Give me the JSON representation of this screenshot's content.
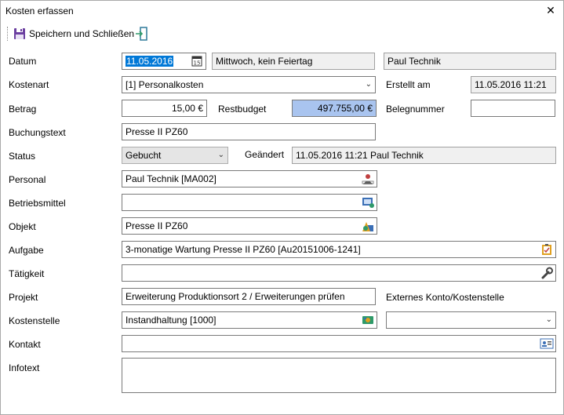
{
  "window": {
    "title": "Kosten erfassen"
  },
  "toolbar": {
    "save_label": "Speichern und Schließen"
  },
  "labels": {
    "datum": "Datum",
    "kostenart": "Kostenart",
    "betrag": "Betrag",
    "buchungstext": "Buchungstext",
    "status": "Status",
    "personal": "Personal",
    "betriebsmittel": "Betriebsmittel",
    "objekt": "Objekt",
    "aufgabe": "Aufgabe",
    "taetigkeit": "Tätigkeit",
    "projekt": "Projekt",
    "kostenstelle": "Kostenstelle",
    "kontakt": "Kontakt",
    "infotext": "Infotext",
    "restbudget": "Restbudget",
    "erstellt_am": "Erstellt am",
    "belegnummer": "Belegnummer",
    "geaendert": "Geändert",
    "externes_konto": "Externes Konto/Kostenstelle"
  },
  "values": {
    "datum": "11.05.2016",
    "wochentag": "Mittwoch, kein Feiertag",
    "erstellt_von": "Paul Technik",
    "kostenart": "[1] Personalkosten",
    "erstellt_am": "11.05.2016 11:21",
    "betrag": "15,00 €",
    "restbudget": "497.755,00 €",
    "belegnummer": "",
    "buchungstext": "Presse II PZ60",
    "status": "Gebucht",
    "geaendert": "11.05.2016 11:21 Paul Technik",
    "personal": "Paul Technik [MA002]",
    "betriebsmittel": "",
    "objekt": "Presse II PZ60",
    "aufgabe": "3-monatige Wartung Presse II PZ60 [Au20151006-1241]",
    "taetigkeit": "",
    "projekt": "Erweiterung Produktionsort 2 / Erweiterungen prüfen",
    "kostenstelle": "Instandhaltung [1000]",
    "externes_konto": "",
    "kontakt": "",
    "infotext": ""
  },
  "colors": {
    "restbudget_bg": "#a9c4ef",
    "selection": "#0078d7"
  },
  "icons": {
    "close": "close-icon",
    "save": "floppy-disk-icon",
    "exit": "exit-door-icon",
    "calendar": "calendar-icon",
    "personal": "person-picker-icon",
    "betriebsmittel": "equipment-picker-icon",
    "objekt": "object-picker-icon",
    "aufgabe": "clipboard-task-icon",
    "taetigkeit": "wrench-icon",
    "kostenstelle": "cost-center-picker-icon",
    "kontakt": "contact-card-icon"
  }
}
